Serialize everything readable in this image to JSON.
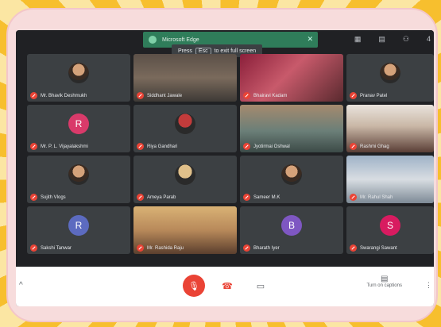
{
  "edge_banner": {
    "title": "Microsoft Edge",
    "close_icon": "close-icon"
  },
  "fullscreen_hint": {
    "press": "Press",
    "key": "Esc",
    "rest": "to exit full screen"
  },
  "top_icons": [
    "grid-icon",
    "chat-icon",
    "people-icon",
    "4"
  ],
  "participants": [
    {
      "name": "Mr. Bhavik Deshmukh",
      "kind": "photo"
    },
    {
      "name": "Siddhant Jawale",
      "kind": "video"
    },
    {
      "name": "Bhairavi Kadam",
      "kind": "video"
    },
    {
      "name": "Pranav Patel",
      "kind": "photo"
    },
    {
      "name": "Mr. P. L. Vijayalakshmi",
      "kind": "avatar",
      "letter": "R",
      "color": "#d93a6a"
    },
    {
      "name": "Riya Gandhari",
      "kind": "photo"
    },
    {
      "name": "Jyotirmai Oshwal",
      "kind": "video"
    },
    {
      "name": "Rashmi Ghag",
      "kind": "video"
    },
    {
      "name": "Sujith Vlogs",
      "kind": "photo"
    },
    {
      "name": "Ameya Parab",
      "kind": "photo"
    },
    {
      "name": "Sameer M.K",
      "kind": "photo"
    },
    {
      "name": "Mr. Rahul Shah",
      "kind": "video"
    },
    {
      "name": "Sakshi Tanwar",
      "kind": "avatar",
      "letter": "R",
      "color": "#5c6bc0"
    },
    {
      "name": "Mr. Rashida Raju",
      "kind": "video"
    },
    {
      "name": "Bharath Iyer",
      "kind": "avatar",
      "letter": "B",
      "color": "#7e57c2"
    },
    {
      "name": "Swarangi Sawant",
      "kind": "avatar",
      "letter": "S",
      "color": "#d81b60"
    }
  ],
  "bottom": {
    "mic_icon": "mic-off-icon",
    "end_call_icon": "hang-up-icon",
    "present_icon": "present-icon",
    "captions_label": "Turn on captions",
    "captions_icon": "captions-icon"
  },
  "colors": {
    "meet_dark": "#202124",
    "tile": "#3c4043",
    "red": "#ea4335",
    "frame": "#f7dcdc",
    "sun": "#f7bf2e"
  }
}
